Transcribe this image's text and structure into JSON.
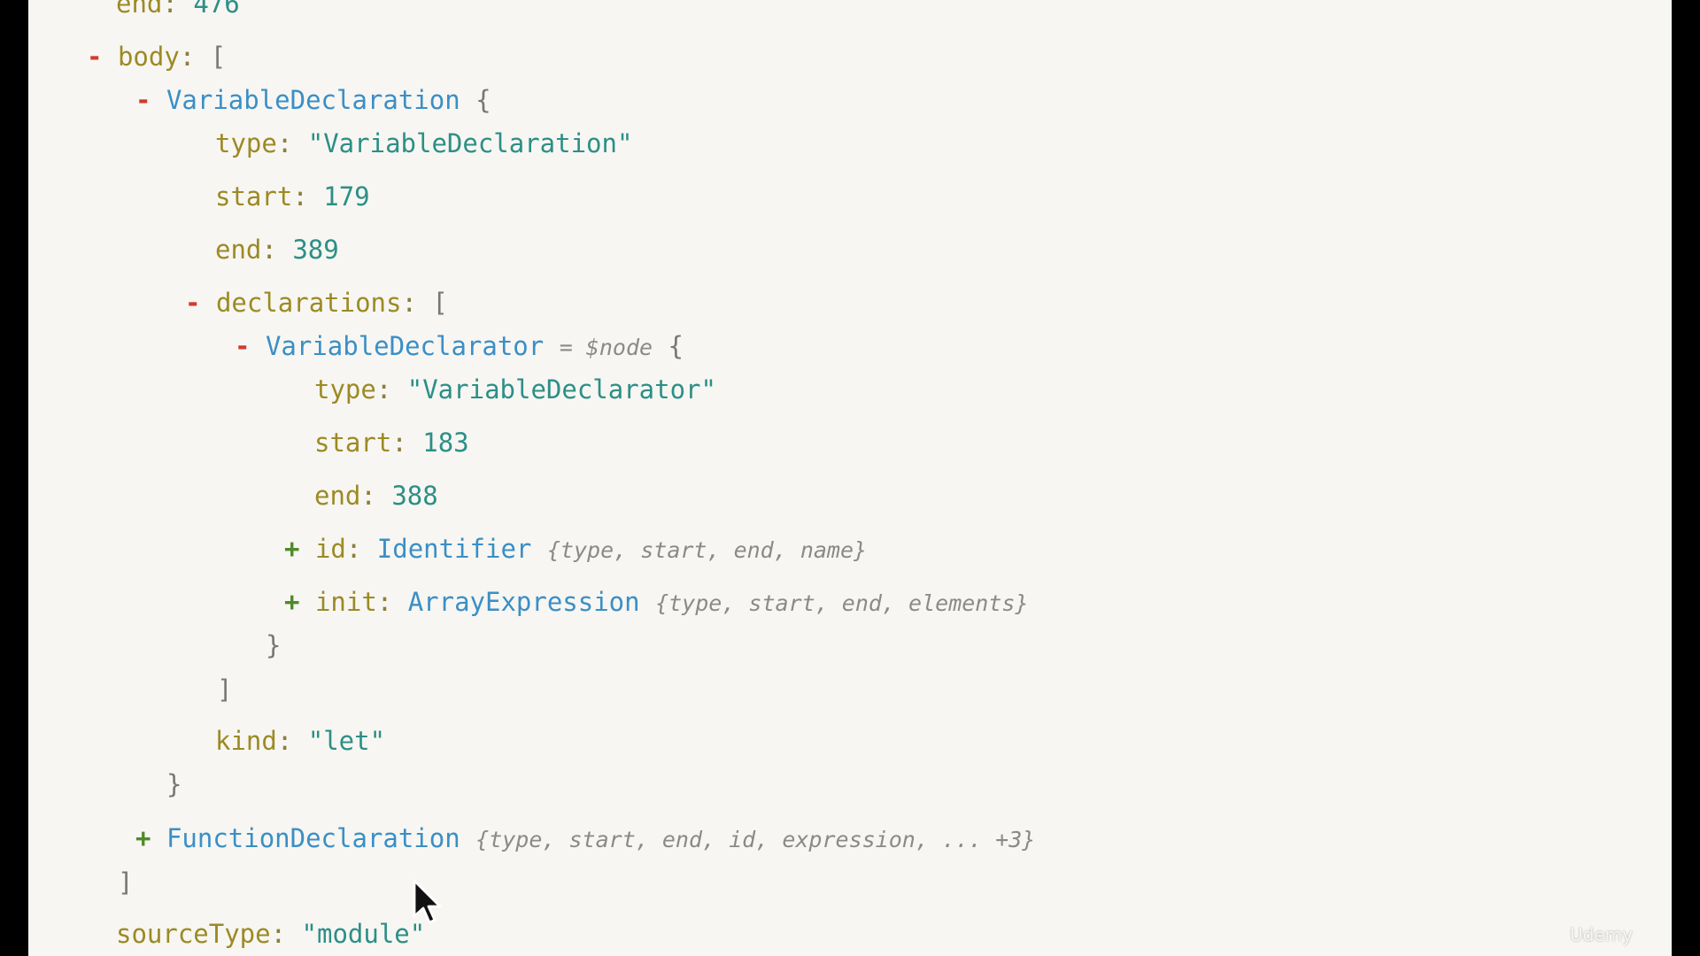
{
  "ast": {
    "top_end": {
      "key": "end",
      "value": "476"
    },
    "body": {
      "toggle": "-",
      "key": "body",
      "open": "[",
      "close": "]"
    },
    "var_decl": {
      "toggle": "-",
      "name": "VariableDeclaration",
      "open": "{",
      "close": "}",
      "type": {
        "key": "type",
        "value": "\"VariableDeclaration\""
      },
      "start": {
        "key": "start",
        "value": "179"
      },
      "end": {
        "key": "end",
        "value": "389"
      },
      "declarations": {
        "toggle": "-",
        "key": "declarations",
        "open": "[",
        "close": "]"
      },
      "kind": {
        "key": "kind",
        "value": "\"let\""
      }
    },
    "declarator": {
      "toggle": "-",
      "name": "VariableDeclarator",
      "alias": "= $node",
      "open": "{",
      "close": "}",
      "type": {
        "key": "type",
        "value": "\"VariableDeclarator\""
      },
      "start": {
        "key": "start",
        "value": "183"
      },
      "end": {
        "key": "end",
        "value": "388"
      },
      "id": {
        "toggle": "+",
        "key": "id",
        "node_type": "Identifier",
        "summary": "{type, start, end, name}"
      },
      "init": {
        "toggle": "+",
        "key": "init",
        "node_type": "ArrayExpression",
        "summary": "{type, start, end, elements}"
      }
    },
    "func_decl": {
      "toggle": "+",
      "name": "FunctionDeclaration",
      "summary": "{type, start, end, id, expression, ... +3}"
    },
    "source_type": {
      "key": "sourceType",
      "value": "\"module\""
    }
  },
  "watermark": "Udemy"
}
